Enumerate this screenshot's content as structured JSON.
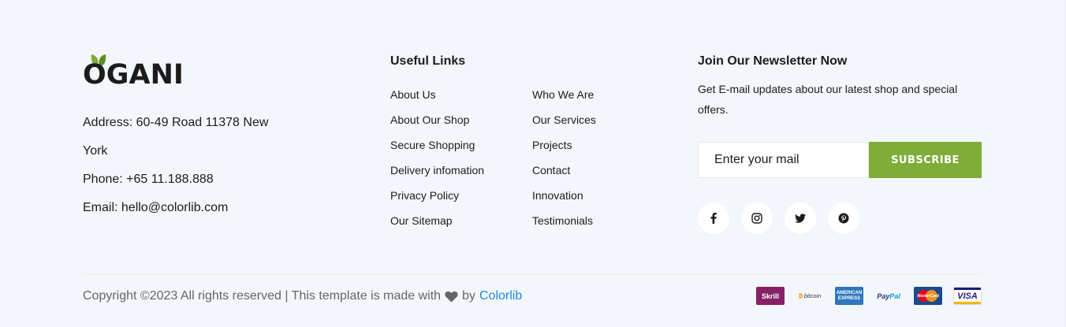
{
  "brand": {
    "logo_text": "OGANI",
    "contact": {
      "address": "Address: 60-49 Road 11378 New York",
      "phone": "Phone: +65 11.188.888",
      "email": "Email: hello@colorlib.com"
    }
  },
  "useful_links": {
    "title": "Useful Links",
    "column_1": [
      "About Us",
      "About Our Shop",
      "Secure Shopping",
      "Delivery infomation",
      "Privacy Policy",
      "Our Sitemap"
    ],
    "column_2": [
      "Who We Are",
      "Our Services",
      "Projects",
      "Contact",
      "Innovation",
      "Testimonials"
    ]
  },
  "newsletter": {
    "title": "Join Our Newsletter Now",
    "description": "Get E-mail updates about our latest shop and special offers.",
    "input_placeholder": "Enter your mail",
    "subscribe_label": "SUBSCRIBE",
    "social_icons": [
      "facebook-icon",
      "instagram-icon",
      "twitter-icon",
      "pinterest-icon"
    ]
  },
  "copyright": {
    "text": "Copyright ©2023 All rights reserved | This template is made with",
    "by_text": "by",
    "link_text": "Colorlib"
  },
  "payments": {
    "skrill": "Skrill",
    "bitcoin": "bitcoin",
    "amex_line1": "AMERICAN",
    "amex_line2": "EXPRESS",
    "paypal_a": "Pay",
    "paypal_b": "Pal",
    "mastercard": "MasterCard",
    "visa": "VISA"
  },
  "colors": {
    "background": "#f3f6fa",
    "accent_green": "#7fad39",
    "link_blue": "#1e88e5",
    "text_dark": "#1c1c1c",
    "text_muted": "#666666"
  }
}
